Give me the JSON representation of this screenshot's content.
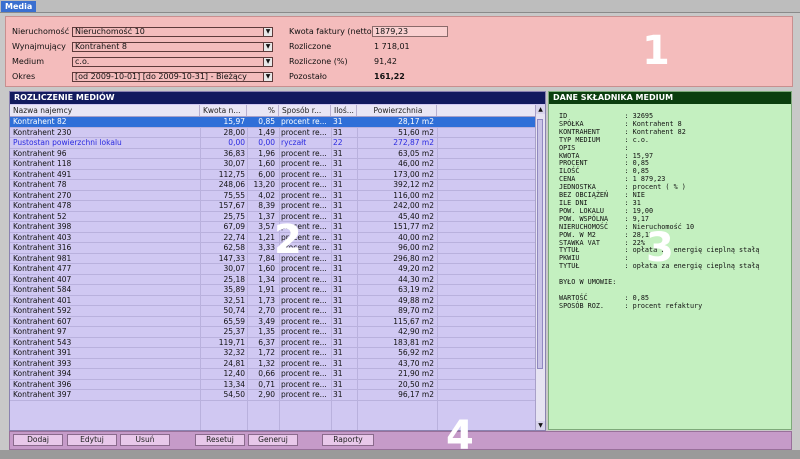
{
  "tab": {
    "label": "Media"
  },
  "form": {
    "nieruchomosc": {
      "label": "Nieruchomość",
      "value": "Nieruchomość 10"
    },
    "wynajmujacy": {
      "label": "Wynajmujący",
      "value": "Kontrahent 8"
    },
    "medium": {
      "label": "Medium",
      "value": "c.o."
    },
    "okres": {
      "label": "Okres",
      "value": "[od 2009-10-01] [do 2009-10-31] - Bieżący"
    },
    "kwota_faktury": {
      "label": "Kwota faktury (netto)",
      "value": "1879,23"
    },
    "rozliczone": {
      "label": "Rozliczone",
      "value": "1 718,01"
    },
    "rozliczone_pct": {
      "label": "Rozliczone (%)",
      "value": "91,42"
    },
    "pozostalo": {
      "label": "Pozostało",
      "value": "161,22"
    }
  },
  "callouts": {
    "one": "1",
    "two": "2",
    "three": "3",
    "four": "4"
  },
  "table": {
    "title": "ROZLICZENIE MEDIÓW",
    "columns": [
      "Nazwa najemcy",
      "Kwota n...",
      "%",
      "Sposób r...",
      "Iloś...",
      "Powierzchnia"
    ],
    "rows": [
      [
        "Kontrahent 82",
        "15,97",
        "0,85",
        "procent re...",
        "31",
        "28,17 m2"
      ],
      [
        "Kontrahent 230",
        "28,00",
        "1,49",
        "procent re...",
        "31",
        "51,60 m2"
      ],
      [
        "Pustostan powierzchni lokalu",
        "0,00",
        "0,00",
        "ryczałt",
        "22",
        "272,87 m2"
      ],
      [
        "Kontrahent 96",
        "36,83",
        "1,96",
        "procent re...",
        "31",
        "63,05 m2"
      ],
      [
        "Kontrahent 118",
        "30,07",
        "1,60",
        "procent re...",
        "31",
        "46,00 m2"
      ],
      [
        "Kontrahent 491",
        "112,75",
        "6,00",
        "procent re...",
        "31",
        "173,00 m2"
      ],
      [
        "Kontrahent 78",
        "248,06",
        "13,20",
        "procent re...",
        "31",
        "392,12 m2"
      ],
      [
        "Kontrahent 270",
        "75,55",
        "4,02",
        "procent re...",
        "31",
        "116,00 m2"
      ],
      [
        "Kontrahent 478",
        "157,67",
        "8,39",
        "procent re...",
        "31",
        "242,00 m2"
      ],
      [
        "Kontrahent 52",
        "25,75",
        "1,37",
        "procent re...",
        "31",
        "45,40 m2"
      ],
      [
        "Kontrahent 398",
        "67,09",
        "3,57",
        "procent re...",
        "31",
        "151,77 m2"
      ],
      [
        "Kontrahent 403",
        "22,74",
        "1,21",
        "procent re...",
        "31",
        "40,00 m2"
      ],
      [
        "Kontrahent 316",
        "62,58",
        "3,33",
        "procent re...",
        "31",
        "96,00 m2"
      ],
      [
        "Kontrahent 981",
        "147,33",
        "7,84",
        "procent re...",
        "31",
        "296,80 m2"
      ],
      [
        "Kontrahent 477",
        "30,07",
        "1,60",
        "procent re...",
        "31",
        "49,20 m2"
      ],
      [
        "Kontrahent 407",
        "25,18",
        "1,34",
        "procent re...",
        "31",
        "44,30 m2"
      ],
      [
        "Kontrahent 584",
        "35,89",
        "1,91",
        "procent re...",
        "31",
        "63,19 m2"
      ],
      [
        "Kontrahent 401",
        "32,51",
        "1,73",
        "procent re...",
        "31",
        "49,88 m2"
      ],
      [
        "Kontrahent 592",
        "50,74",
        "2,70",
        "procent re...",
        "31",
        "89,70 m2"
      ],
      [
        "Kontrahent 607",
        "65,59",
        "3,49",
        "procent re...",
        "31",
        "115,67 m2"
      ],
      [
        "Kontrahent 97",
        "25,37",
        "1,35",
        "procent re...",
        "31",
        "42,90 m2"
      ],
      [
        "Kontrahent 543",
        "119,71",
        "6,37",
        "procent re...",
        "31",
        "183,81 m2"
      ],
      [
        "Kontrahent 391",
        "32,32",
        "1,72",
        "procent re...",
        "31",
        "56,92 m2"
      ],
      [
        "Kontrahent 393",
        "24,81",
        "1,32",
        "procent re...",
        "31",
        "43,70 m2"
      ],
      [
        "Kontrahent 394",
        "12,40",
        "0,66",
        "procent re...",
        "31",
        "21,90 m2"
      ],
      [
        "Kontrahent 396",
        "13,34",
        "0,71",
        "procent re...",
        "31",
        "20,50 m2"
      ],
      [
        "Kontrahent 397",
        "54,50",
        "2,90",
        "procent re...",
        "31",
        "96,17 m2"
      ]
    ]
  },
  "details": {
    "title": "DANE SKŁADNIKA MEDIUM",
    "text": "ID              : 32695\nSPÓŁKA          : Kontrahent 8\nKONTRAHENT      : Kontrahent 82\nTYP MEDIUM      : c.o.\nOPIS            :\nKWOTA           : 15,97\nPROCENT         : 0,85\nILOŚĆ           : 0,85\nCENA            : 1 879,23\nJEDNOSTKA       : procent ( % )\nBEZ OBCIĄŻEŃ    : NIE\nILE DNI         : 31\nPOW. LOKALU     : 19,00\nPOW. WSPÓLNA    : 9,17\nNIERUCHOMOŚĆ    : Nieruchomość 10\nPOW. W M2       : 28,17\nSTAWKA VAT      : 22%\nTYTUŁ           : opłata za energię cieplną stałą\nPKWIU           :\nTYTUŁ           : opłata za energię cieplną stałą\n\nBYŁO W UMOWIE:\n\nWARTOŚĆ         : 0,85\nSPOSÓB ROZ.     : procent refaktury"
  },
  "buttons": {
    "dodaj": "Dodaj",
    "edytuj": "Edytuj",
    "usun": "Usuń",
    "resetuj": "Resetuj",
    "generuj": "Generuj",
    "raporty": "Raporty"
  },
  "icons": {
    "dropdown": "chevron-down-icon",
    "scroll_up": "arrow-up-icon",
    "scroll_down": "arrow-down-icon"
  },
  "colors": {
    "section1": "#f4bcbc",
    "section2": "#d0c8f2",
    "section3": "#c4f0c0",
    "section4": "#c69bc9",
    "selected_row": "#2f6fd8"
  }
}
